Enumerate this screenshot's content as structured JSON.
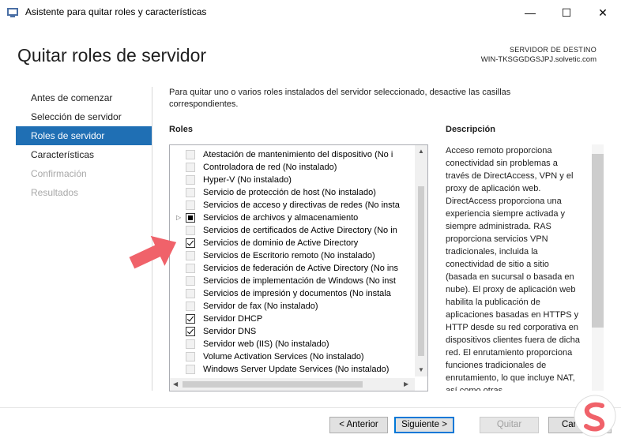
{
  "window": {
    "title": "Asistente para quitar roles y características",
    "minimize_glyph": "—",
    "maximize_glyph": "☐",
    "close_glyph": "✕"
  },
  "header": {
    "title": "Quitar roles de servidor",
    "dest_label": "SERVIDOR DE DESTINO",
    "dest_server": "WIN-TKSGGDGSJPJ.solvetic.com"
  },
  "nav": {
    "items": [
      {
        "label": "Antes de comenzar",
        "state": "normal"
      },
      {
        "label": "Selección de servidor",
        "state": "normal"
      },
      {
        "label": "Roles de servidor",
        "state": "active"
      },
      {
        "label": "Características",
        "state": "normal"
      },
      {
        "label": "Confirmación",
        "state": "disabled"
      },
      {
        "label": "Resultados",
        "state": "disabled"
      }
    ]
  },
  "instructions": "Para quitar uno o varios roles instalados del servidor seleccionado, desactive las casillas correspondientes.",
  "roles": {
    "heading": "Roles",
    "items": [
      {
        "label": "Atestación de mantenimiento del dispositivo (No i",
        "state": "unchecked",
        "expandable": false
      },
      {
        "label": "Controladora de red (No instalado)",
        "state": "unchecked",
        "expandable": false
      },
      {
        "label": "Hyper-V (No instalado)",
        "state": "unchecked",
        "expandable": false
      },
      {
        "label": "Servicio de protección de host (No instalado)",
        "state": "unchecked",
        "expandable": false
      },
      {
        "label": "Servicios de acceso y directivas de redes (No insta",
        "state": "unchecked",
        "expandable": false
      },
      {
        "label": "Servicios de archivos y almacenamiento",
        "state": "partial",
        "expandable": true
      },
      {
        "label": "Servicios de certificados de Active Directory (No in",
        "state": "unchecked",
        "expandable": false
      },
      {
        "label": "Servicios de dominio de Active Directory",
        "state": "checked",
        "expandable": false
      },
      {
        "label": "Servicios de Escritorio remoto (No instalado)",
        "state": "unchecked",
        "expandable": false
      },
      {
        "label": "Servicios de federación de Active Directory (No ins",
        "state": "unchecked",
        "expandable": false
      },
      {
        "label": "Servicios de implementación de Windows (No inst",
        "state": "unchecked",
        "expandable": false
      },
      {
        "label": "Servicios de impresión y documentos (No instala",
        "state": "unchecked",
        "expandable": false
      },
      {
        "label": "Servidor de fax (No instalado)",
        "state": "unchecked",
        "expandable": false
      },
      {
        "label": "Servidor DHCP",
        "state": "checked",
        "expandable": false
      },
      {
        "label": "Servidor DNS",
        "state": "checked",
        "expandable": false
      },
      {
        "label": "Servidor web (IIS) (No instalado)",
        "state": "unchecked",
        "expandable": false
      },
      {
        "label": "Volume Activation Services (No instalado)",
        "state": "unchecked",
        "expandable": false
      },
      {
        "label": "Windows Server Update Services (No instalado)",
        "state": "unchecked",
        "expandable": false
      }
    ]
  },
  "description": {
    "heading": "Descripción",
    "text": "Acceso remoto proporciona conectividad sin problemas a través de DirectAccess, VPN y el proxy de aplicación web. DirectAccess proporciona una experiencia siempre activada y siempre administrada. RAS proporciona servicios VPN tradicionales, incluida la conectividad de sitio a sitio (basada en sucursal o basada en nube). El proxy de aplicación web habilita la publicación de aplicaciones basadas en HTTPS y HTTP desde su red corporativa en dispositivos clientes fuera de dicha red. El enrutamiento proporciona funciones tradicionales de enrutamiento, lo que incluye NAT, así como otras"
  },
  "buttons": {
    "previous": "< Anterior",
    "next": "Siguiente >",
    "remove": "Quitar",
    "cancel": "Cancelar"
  },
  "colors": {
    "accent": "#1f6fb4",
    "arrow": "#f0626a"
  }
}
